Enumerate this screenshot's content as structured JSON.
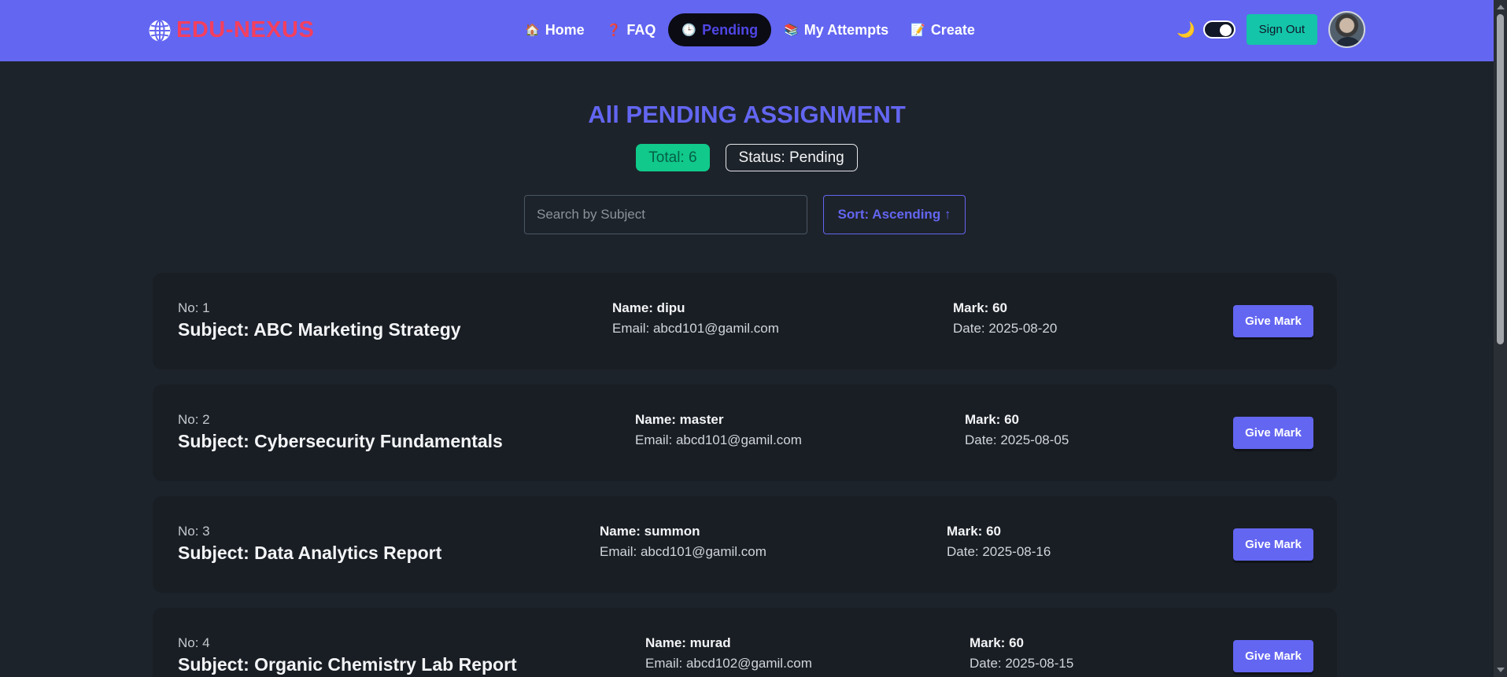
{
  "brand": {
    "name": "EDU-NEXUS"
  },
  "nav": [
    {
      "emoji": "🏠",
      "label": "Home"
    },
    {
      "emoji": "❓",
      "label": "FAQ"
    },
    {
      "emoji": "🕒",
      "label": "Pending"
    },
    {
      "emoji": "📚",
      "label": "My Attempts"
    },
    {
      "emoji": "📝",
      "label": "Create"
    }
  ],
  "header_right": {
    "theme_icon": "🌙",
    "signout_label": "Sign Out"
  },
  "page": {
    "title": "All PENDING ASSIGNMENT",
    "total_badge": "Total: 6",
    "status_badge": "Status: Pending",
    "search_placeholder": "Search by Subject",
    "sort_label": "Sort: Ascending ↑"
  },
  "assignments": [
    {
      "no": "No: 1",
      "subject": "Subject: ABC Marketing Strategy",
      "name": "Name: dipu",
      "email": "Email: abcd101@gamil.com",
      "mark": "Mark: 60",
      "date": "Date: 2025-08-20",
      "button": "Give Mark"
    },
    {
      "no": "No: 2",
      "subject": "Subject: Cybersecurity Fundamentals",
      "name": "Name: master",
      "email": "Email: abcd101@gamil.com",
      "mark": "Mark: 60",
      "date": "Date: 2025-08-05",
      "button": "Give Mark"
    },
    {
      "no": "No: 3",
      "subject": "Subject: Data Analytics Report",
      "name": "Name: summon",
      "email": "Email: abcd101@gamil.com",
      "mark": "Mark: 60",
      "date": "Date: 2025-08-16",
      "button": "Give Mark"
    },
    {
      "no": "No: 4",
      "subject": "Subject: Organic Chemistry Lab Report",
      "name": "Name: murad",
      "email": "Email: abcd102@gamil.com",
      "mark": "Mark: 60",
      "date": "Date: 2025-08-15",
      "button": "Give Mark"
    }
  ],
  "colors": {
    "primary": "#6366f1",
    "brand": "#f43f5e",
    "success": "#10c98a",
    "teal": "#14c5a9",
    "background": "#1d232a",
    "card": "#191e24"
  }
}
